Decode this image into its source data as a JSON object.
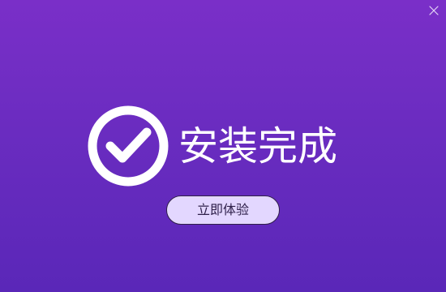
{
  "window": {
    "title": "安装完成",
    "close_icon": "close-icon",
    "success_icon": "check-circle-icon"
  },
  "actions": {
    "primary_button_label": "立即体验"
  },
  "colors": {
    "background_top": "#7a2fc8",
    "background_bottom": "#5a27b8",
    "text_primary": "#ffffff",
    "button_fill": "#e3d7ff",
    "button_border": "#2f1f48",
    "button_text": "#2f204a"
  }
}
